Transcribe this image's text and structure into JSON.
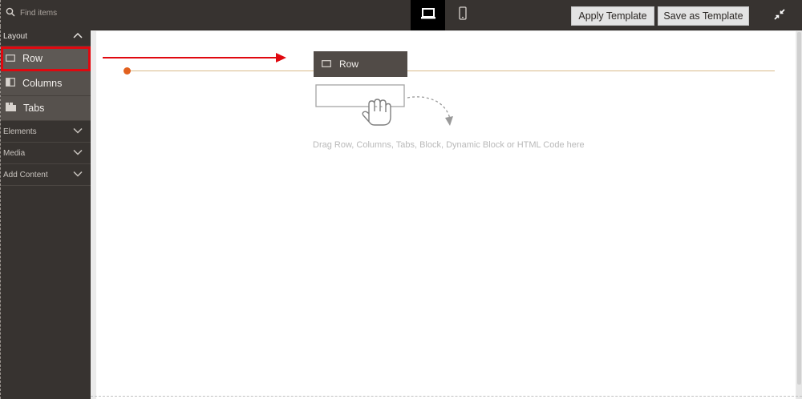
{
  "search": {
    "placeholder": "Find items"
  },
  "toolbar": {
    "desktop_view": "desktop-icon",
    "mobile_view": "mobile-icon",
    "apply_template_label": "Apply Template",
    "save_template_label": "Save as Template",
    "fullscreen_icon": "collapse-icon"
  },
  "sidebar": {
    "layout_group": {
      "label": "Layout",
      "expanded": true,
      "items": [
        {
          "label": "Row",
          "icon": "row-icon"
        },
        {
          "label": "Columns",
          "icon": "columns-icon"
        },
        {
          "label": "Tabs",
          "icon": "tabs-icon"
        }
      ]
    },
    "collapsed_groups": [
      {
        "label": "Elements"
      },
      {
        "label": "Media"
      },
      {
        "label": "Add Content"
      }
    ]
  },
  "stage": {
    "drag_ghost_label": "Row",
    "drop_hint_text": "Drag Row, Columns, Tabs, Block, Dynamic Block or HTML Code here"
  },
  "colors": {
    "highlight": "#e0080f",
    "drop_indicator": "#e2611f",
    "dark_panel": "#373330"
  }
}
